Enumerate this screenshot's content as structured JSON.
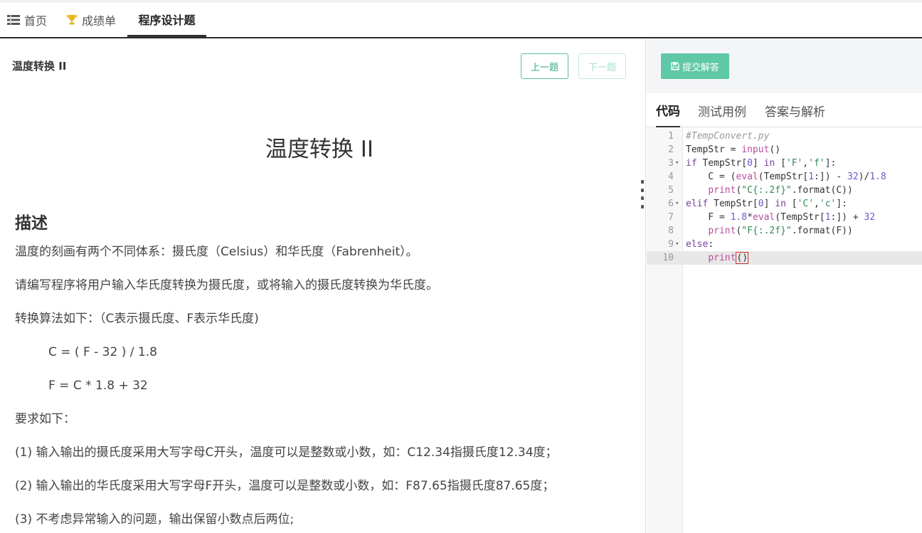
{
  "nav": {
    "home": "首页",
    "score": "成绩单",
    "program": "程序设计题"
  },
  "question": {
    "small_title": "温度转换 II",
    "prev": "上一题",
    "next": "下一题",
    "big_title": "温度转换 II",
    "section_title": "描述",
    "paragraphs": [
      "温度的刻画有两个不同体系：摄氏度（Celsius）和华氏度（Fabrenheit）。",
      "请编写程序将用户输入华氏度转换为摄氏度，或将输入的摄氏度转换为华氏度。",
      "转换算法如下：（C表示摄氏度、F表示华氏度)",
      "C = ( F - 32 ) / 1.8",
      "F = C * 1.8 + 32",
      "要求如下：",
      "(1) 输入输出的摄氏度采用大写字母C开头，温度可以是整数或小数，如：C12.34指摄氏度12.34度；",
      "(2) 输入输出的华氏度采用大写字母F开头，温度可以是整数或小数，如：F87.65指摄氏度87.65度；",
      "(3) 不考虑异常输入的问题，输出保留小数点后两位;"
    ]
  },
  "right": {
    "submit": "提交解答",
    "tabs": [
      "代码",
      "测试用例",
      "答案与解析"
    ]
  },
  "editor": {
    "line_numbers": [
      "1",
      "2",
      "3",
      "4",
      "5",
      "6",
      "7",
      "8",
      "9",
      "10"
    ],
    "lines": [
      "#TempConvert.py",
      "TempStr = input()",
      "if TempStr[0] in ['F','f']:",
      "    C = (eval(TempStr[1:]) - 32)/1.8",
      "    print(\"C{:.2f}\".format(C))",
      "elif TempStr[0] in ['C','c']:",
      "    F = 1.8*eval(TempStr[1:]) + 32",
      "    print(\"F{:.2f}\".format(F))",
      "else:",
      "    print()"
    ]
  },
  "colors": {
    "accent": "#5fc8a6",
    "comment": "#999999",
    "keyword": "#7a3e9d",
    "string": "#2e8b57",
    "builtin": "#b44f9c",
    "number": "#6a5acd"
  }
}
